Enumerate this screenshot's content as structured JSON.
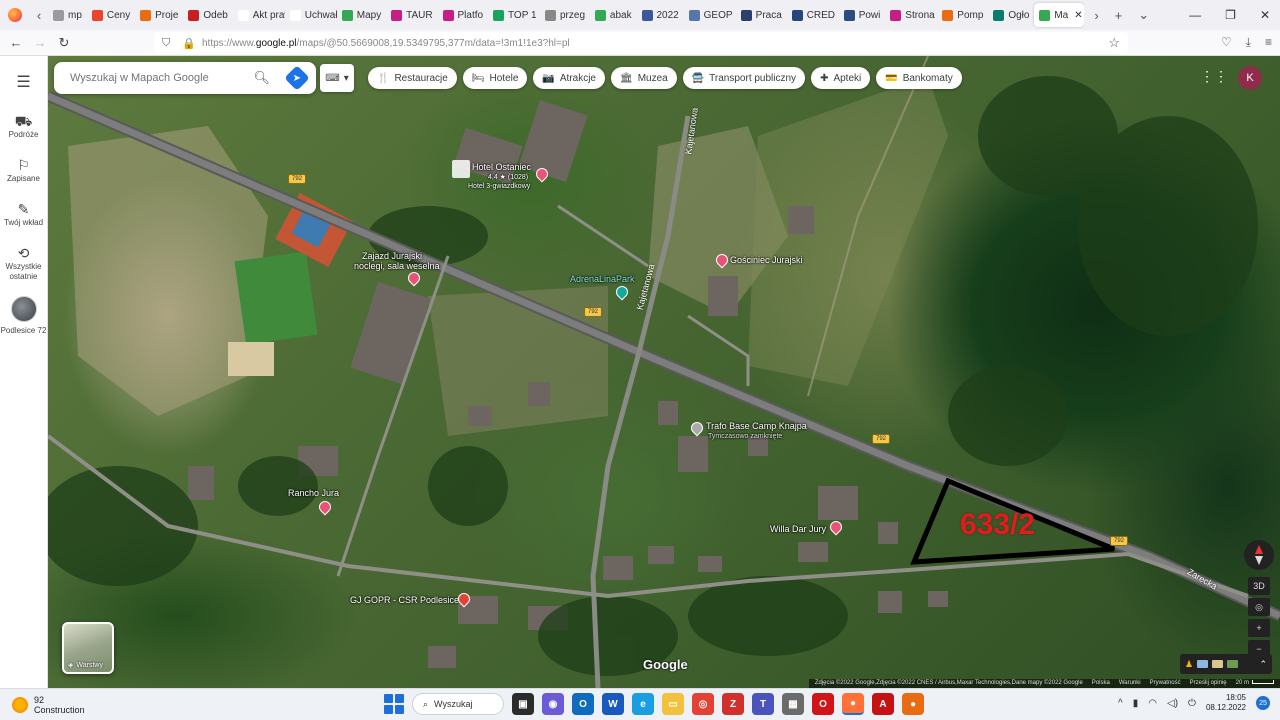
{
  "browser": {
    "tabs": [
      {
        "label": "mp",
        "color": "#9a9aa0"
      },
      {
        "label": "Ceny",
        "color": "#e8462b"
      },
      {
        "label": "Proje",
        "color": "#e96c13"
      },
      {
        "label": "Odeb",
        "color": "#c5221f"
      },
      {
        "label": "Akt prawn",
        "color": "#ffffff"
      },
      {
        "label": "Uchwała",
        "color": "#ffffff"
      },
      {
        "label": "Mapy",
        "color": "#34a853"
      },
      {
        "label": "TAUR",
        "color": "#c51f86"
      },
      {
        "label": "Platfo",
        "color": "#c51f86"
      },
      {
        "label": "TOP 1",
        "color": "#1aa360"
      },
      {
        "label": "przeg",
        "color": "#888888"
      },
      {
        "label": "abak",
        "color": "#34a853"
      },
      {
        "label": "2022",
        "color": "#3b5998"
      },
      {
        "label": "GEOP",
        "color": "#5577aa"
      },
      {
        "label": "Praca",
        "color": "#2c3e6b"
      },
      {
        "label": "CRED",
        "color": "#26457a"
      },
      {
        "label": "Powi",
        "color": "#2b4a80"
      },
      {
        "label": "Strona",
        "color": "#c51f86"
      },
      {
        "label": "Pomp",
        "color": "#e96c13"
      },
      {
        "label": "Ogło",
        "color": "#0a7d6a"
      },
      {
        "label": "Ma",
        "color": "#34a853",
        "active": true
      }
    ],
    "url_prefix": "https://www.",
    "url_host": "google.pl",
    "url_rest": "/maps/@50.5669008,19.5349795,377m/data=!3m1!1e3?hl=pl"
  },
  "rail": {
    "items": [
      {
        "icon": "car-icon",
        "glyph": "⛟",
        "label": "Podróże"
      },
      {
        "icon": "bookmark-icon",
        "glyph": "⚐",
        "label": "Zapisane"
      },
      {
        "icon": "contribute-icon",
        "glyph": "✎",
        "label": "Twój wkład"
      },
      {
        "icon": "history-icon",
        "glyph": "⟲",
        "label": "Wszystkie ostatnie"
      }
    ],
    "recent_place": "Podlesice 72"
  },
  "search": {
    "placeholder": "Wyszukaj w Mapach Google"
  },
  "chips": [
    {
      "icon": "restaurant-icon",
      "glyph": "🍴",
      "label": "Restauracje"
    },
    {
      "icon": "hotel-icon",
      "glyph": "🛏",
      "label": "Hotele"
    },
    {
      "icon": "attraction-icon",
      "glyph": "📷",
      "label": "Atrakcje"
    },
    {
      "icon": "museum-icon",
      "glyph": "🏛",
      "label": "Muzea"
    },
    {
      "icon": "transit-icon",
      "glyph": "🚍",
      "label": "Transport publiczny"
    },
    {
      "icon": "pharmacy-icon",
      "glyph": "✚",
      "label": "Apteki"
    },
    {
      "icon": "atm-icon",
      "glyph": "💳",
      "label": "Bankomaty"
    }
  ],
  "account_initial": "K",
  "map": {
    "places": {
      "hotel_name": "Hotel Ostaniec",
      "hotel_rating": "4,4 ★ (1028)",
      "hotel_type": "Hotel 3-gwiazdkowy",
      "zajazd_line1": "Zajazd Jurajski",
      "zajazd_line2": "noclegi, sala weselna",
      "adrenalina": "AdrenaLinaPark",
      "gosciniec": "Gościniec Jurajski",
      "trafo": "Trafo Base Camp Knajpa",
      "trafo_status": "Tymczasowo zamknięte",
      "rancho": "Rancho Jura",
      "willa": "Willa Dar Jury",
      "gopr": "GJ GOPR - CSR Podlesice"
    },
    "road_numbers": [
      "792",
      "792",
      "792",
      "792"
    ],
    "streets": {
      "kajetanowa_1": "Kajetanowa",
      "kajetanowa_2": "Kajetanowa",
      "zarecka": "Zarecka"
    },
    "parcel": "633/2",
    "parcel_color": "#e31b1b",
    "layers_label": "Warstwy",
    "google_logo": "Google",
    "attribution": "Zdjęcia ©2022 Google,Zdjęcia ©2022 CNES / Airbus,Maxar Technologies,Dane mapy ©2022 Google",
    "attribution_links": [
      "Polska",
      "Warunki",
      "Prywatność",
      "Prześlij opinię"
    ],
    "scale": "20 m",
    "controls": {
      "three_d": "3D",
      "zoom_in": "+",
      "zoom_out": "−"
    }
  },
  "taskbar": {
    "weather_temp": "92",
    "weather_text": "Construction",
    "search_label": "Wyszukaj",
    "time": "18:05",
    "date": "08.12.2022",
    "notifications": "25"
  }
}
